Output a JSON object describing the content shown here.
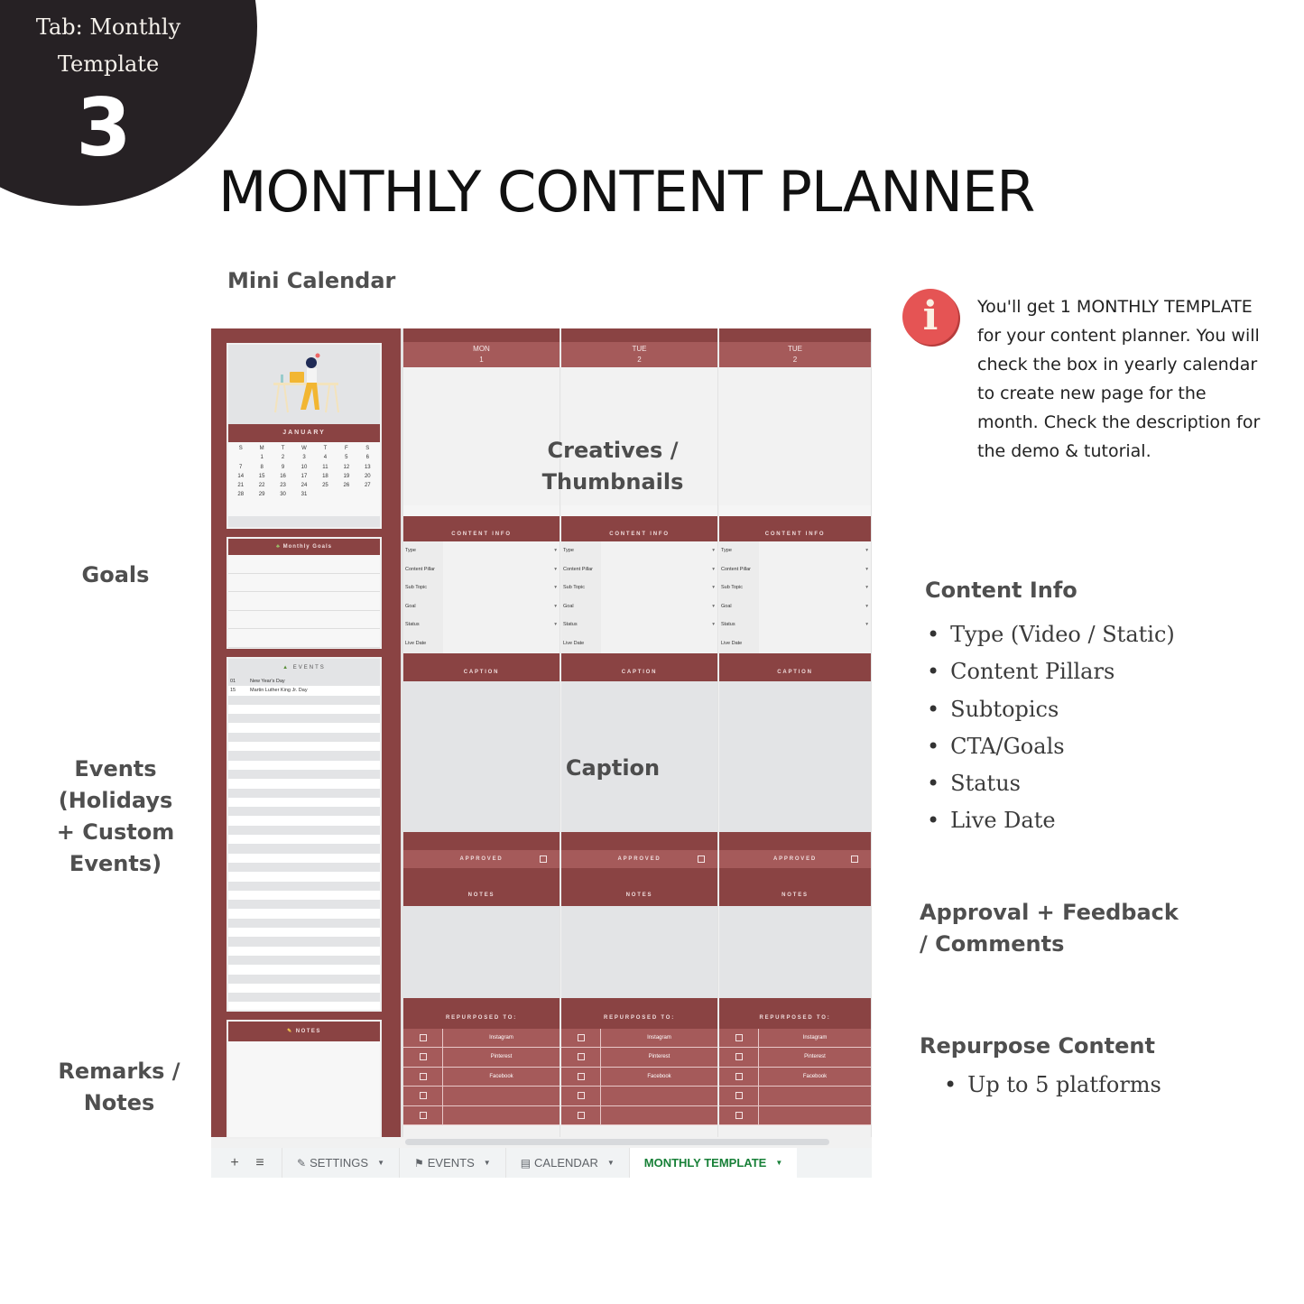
{
  "badge": {
    "tab_label": "Tab: Monthly Template",
    "number": "3"
  },
  "title": "MONTHLY CONTENT PLANNER",
  "labels": {
    "mini_calendar": "Mini Calendar",
    "goals": "Goals",
    "events": "Events (Holidays + Custom Events)",
    "remarks": "Remarks / Notes"
  },
  "mini_calendar": {
    "month": "JANUARY",
    "weekdays": [
      "S",
      "M",
      "T",
      "W",
      "T",
      "F",
      "S"
    ],
    "days": [
      "",
      "1",
      "2",
      "3",
      "4",
      "5",
      "6",
      "7",
      "8",
      "9",
      "10",
      "11",
      "12",
      "13",
      "14",
      "15",
      "16",
      "17",
      "18",
      "19",
      "20",
      "21",
      "22",
      "23",
      "24",
      "25",
      "26",
      "27",
      "28",
      "29",
      "30",
      "31"
    ]
  },
  "goals": {
    "header": "Monthly Goals",
    "rows": 5
  },
  "events": {
    "header": "EVENTS",
    "items": [
      {
        "day": "01",
        "name": "New Year's Day"
      },
      {
        "day": "15",
        "name": "Martin Luther King Jr. Day"
      }
    ]
  },
  "notes": {
    "header": "NOTES"
  },
  "day_columns": [
    {
      "weekday": "MON",
      "date": "1"
    },
    {
      "weekday": "TUE",
      "date": "2"
    },
    {
      "weekday": "TUE",
      "date": "2"
    }
  ],
  "content_info": {
    "header": "CONTENT INFO",
    "fields": [
      "Type",
      "Content Pillar",
      "Sub Topic",
      "Goal",
      "Status",
      "Live Date"
    ],
    "dropdown_fields": [
      "Type",
      "Content Pillar",
      "Sub Topic",
      "Goal",
      "Status"
    ]
  },
  "caption": {
    "header": "CAPTION"
  },
  "approved": {
    "label": "APPROVED",
    "checked": false
  },
  "notes_col": {
    "header": "NOTES"
  },
  "repurpose": {
    "header": "REPURPOSED TO:",
    "platforms": [
      "Instagram",
      "Pinterest",
      "Facebook",
      "",
      ""
    ]
  },
  "overlays": {
    "creatives": "Creatives / Thumbnails",
    "caption": "Caption"
  },
  "tabs": [
    {
      "label": "SETTINGS",
      "icon": "memo-icon",
      "active": false
    },
    {
      "label": "EVENTS",
      "icon": "palm-tree-icon",
      "active": false
    },
    {
      "label": "CALENDAR",
      "icon": "calendar-icon",
      "active": false
    },
    {
      "label": "MONTHLY TEMPLATE",
      "icon": "",
      "active": true
    }
  ],
  "info": {
    "text": "You'll get 1 MONTHLY TEMPLATE for your content planner. You will check the box in yearly calendar to create new page for the month. Check the description for the demo & tutorial."
  },
  "right": {
    "content_info_title": "Content Info",
    "content_info_items": [
      "Type (Video / Static)",
      "Content Pillars",
      "Subtopics",
      "CTA/Goals",
      "Status",
      "Live Date"
    ],
    "approval_title": "Approval + Feedback / Comments",
    "repurpose_title": "Repurpose Content",
    "repurpose_items": [
      "Up to 5 platforms"
    ]
  },
  "colors": {
    "primary": "#8a4343",
    "secondary": "#a55a5a",
    "info": "#e55454",
    "active_tab": "#188038"
  }
}
